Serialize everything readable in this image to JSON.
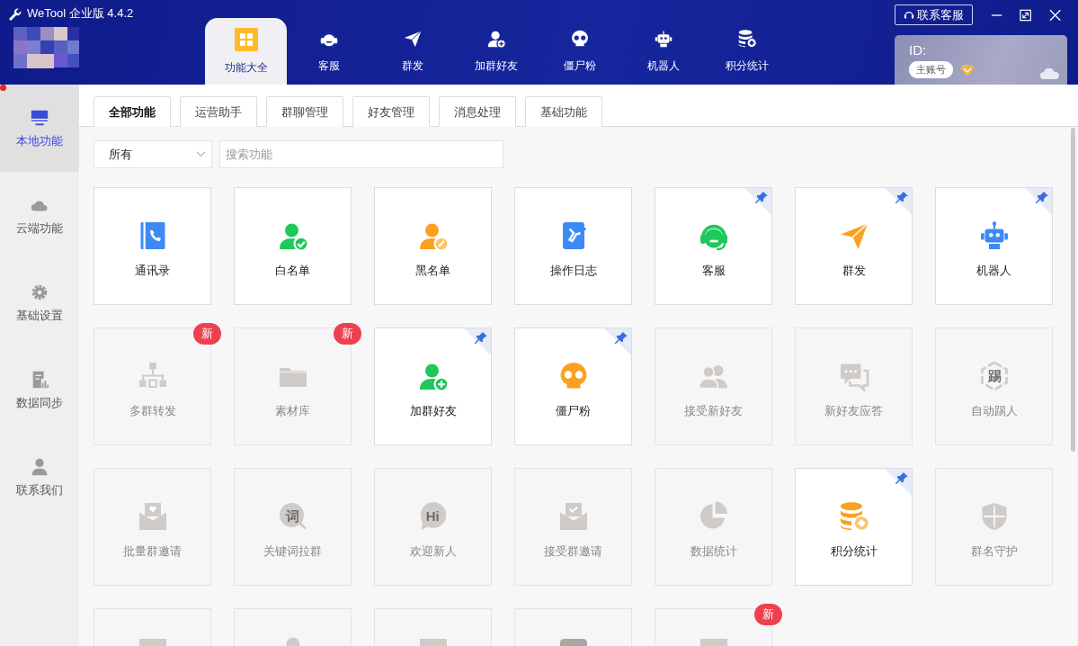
{
  "window": {
    "title": "WeTool 企业版 4.4.2"
  },
  "support_button": {
    "label": "联系客服"
  },
  "nav": [
    {
      "label": "功能大全",
      "selected": true
    },
    {
      "label": "客服",
      "selected": false
    },
    {
      "label": "群发",
      "selected": false
    },
    {
      "label": "加群好友",
      "selected": false
    },
    {
      "label": "僵尸粉",
      "selected": false
    },
    {
      "label": "机器人",
      "selected": false
    },
    {
      "label": "积分统计",
      "selected": false
    }
  ],
  "account": {
    "id_label": "ID:",
    "role": "主账号"
  },
  "sidebar": {
    "alert_dot": true,
    "items": [
      {
        "label": "本地功能",
        "selected": true
      },
      {
        "label": "云端功能",
        "selected": false
      },
      {
        "label": "基础设置",
        "selected": false
      },
      {
        "label": "数据同步",
        "selected": false
      },
      {
        "label": "联系我们",
        "selected": false
      }
    ]
  },
  "tabs": [
    {
      "label": "全部功能",
      "selected": true
    },
    {
      "label": "运营助手",
      "selected": false
    },
    {
      "label": "群聊管理",
      "selected": false
    },
    {
      "label": "好友管理",
      "selected": false
    },
    {
      "label": "消息处理",
      "selected": false
    },
    {
      "label": "基础功能",
      "selected": false
    }
  ],
  "filter": {
    "value": "所有"
  },
  "search": {
    "placeholder": "搜索功能"
  },
  "cards": [
    {
      "label": "通讯录",
      "disabled": false,
      "pinned": false
    },
    {
      "label": "白名单",
      "disabled": false,
      "pinned": false
    },
    {
      "label": "黑名单",
      "disabled": false,
      "pinned": false
    },
    {
      "label": "操作日志",
      "disabled": false,
      "pinned": false
    },
    {
      "label": "客服",
      "disabled": false,
      "pinned": true
    },
    {
      "label": "群发",
      "disabled": false,
      "pinned": true
    },
    {
      "label": "机器人",
      "disabled": false,
      "pinned": true
    },
    {
      "label": "多群转发",
      "disabled": true,
      "pinned": false,
      "badge": "新"
    },
    {
      "label": "素材库",
      "disabled": true,
      "pinned": false,
      "badge": "新"
    },
    {
      "label": "加群好友",
      "disabled": false,
      "pinned": true
    },
    {
      "label": "僵尸粉",
      "disabled": false,
      "pinned": true
    },
    {
      "label": "接受新好友",
      "disabled": true,
      "pinned": false
    },
    {
      "label": "新好友应答",
      "disabled": true,
      "pinned": false
    },
    {
      "label": "自动踢人",
      "disabled": true,
      "pinned": false,
      "icon_text": "踢"
    },
    {
      "label": "批量群邀请",
      "disabled": true,
      "pinned": false
    },
    {
      "label": "关键词拉群",
      "disabled": true,
      "pinned": false,
      "icon_text": "词"
    },
    {
      "label": "欢迎新人",
      "disabled": true,
      "pinned": false,
      "icon_text": "Hi"
    },
    {
      "label": "接受群邀请",
      "disabled": true,
      "pinned": false
    },
    {
      "label": "数据统计",
      "disabled": true,
      "pinned": false
    },
    {
      "label": "积分统计",
      "disabled": false,
      "pinned": true
    },
    {
      "label": "群名守护",
      "disabled": true,
      "pinned": false
    },
    {
      "disabled": true,
      "pinned": false
    },
    {
      "disabled": true,
      "pinned": false
    },
    {
      "disabled": true,
      "pinned": false
    },
    {
      "disabled": true,
      "pinned": false
    },
    {
      "disabled": true,
      "pinned": false,
      "badge": "新"
    }
  ]
}
